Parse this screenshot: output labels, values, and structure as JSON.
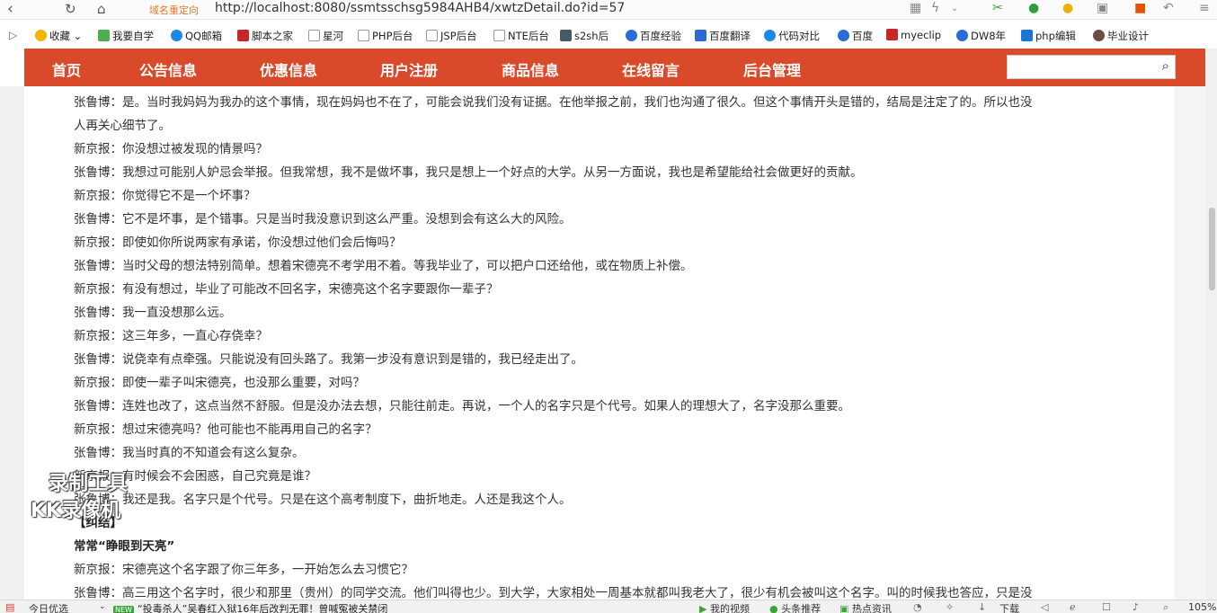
{
  "browser": {
    "redirect_label": "域名重定向",
    "url": "http://localhost:8080/ssmtsschsg5984AHB4/xwtzDetail.do?id=57",
    "zoom": "105%"
  },
  "bookmarks": [
    {
      "label": "收藏",
      "color": "#f4b400"
    },
    {
      "label": "我要自学",
      "color": "#4caf50"
    },
    {
      "label": "QQ邮箱",
      "color": "#1e88e5"
    },
    {
      "label": "脚本之家",
      "color": "#c62828"
    },
    {
      "label": "星河",
      "color": "#bbbbbb"
    },
    {
      "label": "PHP后台",
      "color": "#bbbbbb"
    },
    {
      "label": "JSP后台",
      "color": "#bbbbbb"
    },
    {
      "label": "NTE后台",
      "color": "#bbbbbb"
    },
    {
      "label": "s2sh后",
      "color": "#455a64"
    },
    {
      "label": "百度经验",
      "color": "#2a6bd6"
    },
    {
      "label": "百度翻译",
      "color": "#2a6bd6"
    },
    {
      "label": "代码对比",
      "color": "#1e88e5"
    },
    {
      "label": "百度",
      "color": "#2a6bd6"
    },
    {
      "label": "myeclip",
      "color": "#c62828"
    },
    {
      "label": "DW8年",
      "color": "#2a6bd6"
    },
    {
      "label": "php编辑",
      "color": "#1976d2"
    },
    {
      "label": "毕业设计",
      "color": "#6d4c41"
    }
  ],
  "nav": [
    {
      "label": "首页"
    },
    {
      "label": "公告信息"
    },
    {
      "label": "优惠信息"
    },
    {
      "label": "用户注册"
    },
    {
      "label": "商品信息"
    },
    {
      "label": "在线留言"
    },
    {
      "label": "后台管理"
    }
  ],
  "search": {
    "placeholder": ""
  },
  "article": {
    "lines": [
      {
        "text": "张鲁博：是。当时我妈妈为我办的这个事情，现在妈妈也不在了，可能会说我们没有证据。在他举报之前，我们也沟通了很久。但这个事情开头是错的，结局是注定了的。所以也没",
        "bold": false
      },
      {
        "text": "人再关心细节了。",
        "bold": false
      },
      {
        "text": "新京报：你没想过被发现的情景吗？",
        "bold": false
      },
      {
        "text": "张鲁博：我想过可能别人妒忌会举报。但我常想，我不是做坏事，我只是想上一个好点的大学。从另一方面说，我也是希望能给社会做更好的贡献。",
        "bold": false
      },
      {
        "text": "新京报：你觉得它不是一个坏事？",
        "bold": false
      },
      {
        "text": "张鲁博：它不是坏事，是个错事。只是当时我没意识到这么严重。没想到会有这么大的风险。",
        "bold": false
      },
      {
        "text": "新京报：即使如你所说两家有承诺，你没想过他们会后悔吗？",
        "bold": false
      },
      {
        "text": "张鲁博：当时父母的想法特别简单。想着宋德亮不考学用不着。等我毕业了，可以把户口还给他，或在物质上补偿。",
        "bold": false
      },
      {
        "text": "新京报：有没有想过，毕业了可能改不回名字，宋德亮这个名字要跟你一辈子？",
        "bold": false
      },
      {
        "text": "张鲁博：我一直没想那么远。",
        "bold": false
      },
      {
        "text": "新京报：这三年多，一直心存侥幸？",
        "bold": false
      },
      {
        "text": "张鲁博：说侥幸有点牵强。只能说没有回头路了。我第一步没有意识到是错的，我已经走出了。",
        "bold": false
      },
      {
        "text": "新京报：即使一辈子叫宋德亮，也没那么重要，对吗？",
        "bold": false
      },
      {
        "text": "张鲁博：连姓也改了，这点当然不舒服。但是没办法去想，只能往前走。再说，一个人的名字只是个代号。如果人的理想大了，名字没那么重要。",
        "bold": false
      },
      {
        "text": "新京报：想过宋德亮吗？他可能也不能再用自己的名字？",
        "bold": false
      },
      {
        "text": "张鲁博：我当时真的不知道会有这么复杂。",
        "bold": false
      },
      {
        "text": "新京报：有时候会不会困惑，自己究竟是谁？",
        "bold": false
      },
      {
        "text": "张鲁博：我还是我。名字只是个代号。只是在这个高考制度下，曲折地走。人还是我这个人。",
        "bold": false
      },
      {
        "text": "【纠结】",
        "bold": true
      },
      {
        "text": "常常“睁眼到天亮”",
        "bold": true
      },
      {
        "text": "新京报：宋德亮这个名字跟了你三年多，一开始怎么去习惯它？",
        "bold": false
      },
      {
        "text": "张鲁博：高三用这个名字时，很少和那里（贵州）的同学交流。他们叫得也少。到大学，大家相处一周基本就都叫我老大了，很少有机会被叫这个名字。叫的时候我也答应，只是没",
        "bold": false
      }
    ]
  },
  "watermark": {
    "line1": "录制工具",
    "line2": "KK录像机"
  },
  "status": {
    "today": "今日优选",
    "new_badge": "NEW",
    "headline": "“投毒杀人”吴春红入狱16年后改判无罪！曾喊冤被关禁闭",
    "items": [
      "我的视频",
      "头条推荐",
      "热点资讯",
      "下载"
    ]
  }
}
